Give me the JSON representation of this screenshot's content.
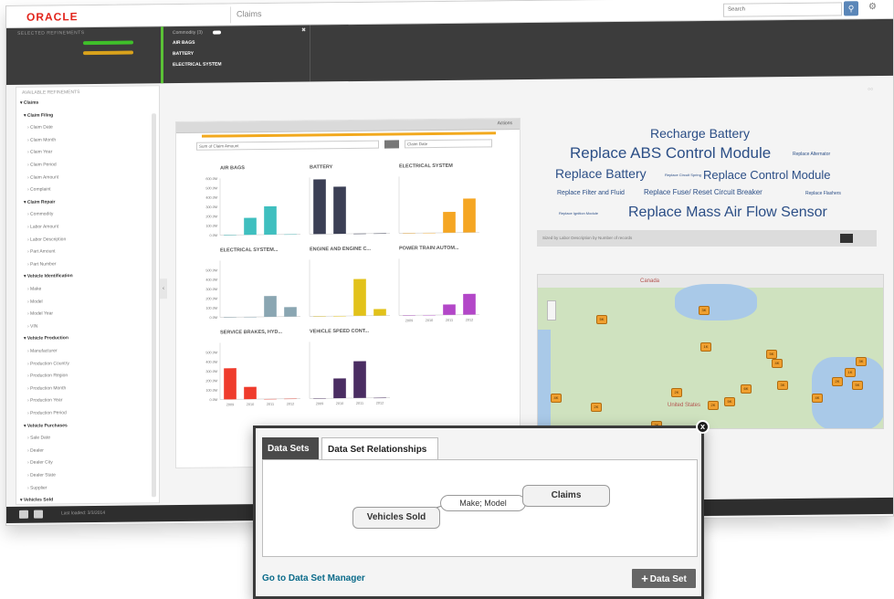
{
  "header": {
    "logo": "ORACLE",
    "app_title": "Claims",
    "search_placeholder": "Search"
  },
  "refinements": {
    "heading": "SELECTED REFINEMENTS",
    "rows": [
      {
        "label": "",
        "value": "",
        "color": "#3fbf2a"
      },
      {
        "label": "",
        "value": "",
        "color": "#d9a21c"
      }
    ],
    "attribute_title": "Commodity (3)",
    "attribute_values": [
      "AIR BAGS",
      "BATTERY",
      "ELECTRICAL SYSTEM"
    ]
  },
  "sidebar": {
    "title": "AVAILABLE REFINEMENTS",
    "groups": [
      {
        "label": "Claims",
        "items": [
          {
            "label": "Claim Filing",
            "group": true
          },
          {
            "label": "Claim Date"
          },
          {
            "label": "Claim Month"
          },
          {
            "label": "Claim Year"
          },
          {
            "label": "Claim Period"
          },
          {
            "label": "Claim Amount"
          },
          {
            "label": "Complaint"
          },
          {
            "label": "Claim Repair",
            "group": true
          },
          {
            "label": "Commodity"
          },
          {
            "label": "Labor Amount"
          },
          {
            "label": "Labor Description"
          },
          {
            "label": "Part Amount"
          },
          {
            "label": "Part Number"
          },
          {
            "label": "Vehicle Identification",
            "group": true
          },
          {
            "label": "Make"
          },
          {
            "label": "Model"
          },
          {
            "label": "Model Year"
          },
          {
            "label": "VIN"
          },
          {
            "label": "Vehicle Production",
            "group": true
          },
          {
            "label": "Manufacturer"
          },
          {
            "label": "Production Country"
          },
          {
            "label": "Production Region"
          },
          {
            "label": "Production Month"
          },
          {
            "label": "Production Year"
          },
          {
            "label": "Production Period"
          },
          {
            "label": "Vehicle Purchases",
            "group": true
          },
          {
            "label": "Sale Date"
          },
          {
            "label": "Dealer"
          },
          {
            "label": "Dealer City"
          },
          {
            "label": "Dealer State"
          },
          {
            "label": "Supplier"
          }
        ]
      },
      {
        "label": "Vehicles Sold",
        "items": []
      }
    ]
  },
  "chart_panel": {
    "actions_label": "Actions",
    "metric_select": "Sum of Claim Amount",
    "time_select": "Claim Date",
    "cells": [
      {
        "title": "AIR BAGS"
      },
      {
        "title": "BATTERY"
      },
      {
        "title": "ELECTRICAL SYSTEM"
      },
      {
        "title": "ELECTRICAL SYSTEM..."
      },
      {
        "title": "ENGINE AND ENGINE C..."
      },
      {
        "title": "POWER TRAIN:AUTOM..."
      },
      {
        "title": "SERVICE BRAKES, HYD..."
      },
      {
        "title": "VEHICLE SPEED CONT..."
      }
    ]
  },
  "chart_data": [
    {
      "type": "bar",
      "title": "AIR BAGS",
      "categories": [
        "2009",
        "2010",
        "2011",
        "2012"
      ],
      "values": [
        0,
        180,
        300,
        0
      ],
      "color": "#3fbfbf",
      "ylim": [
        0,
        600
      ],
      "ylabels": [
        "0.0M",
        "100.0M",
        "200.0M",
        "300.0M",
        "400.0M",
        "500.0M",
        "600.0M"
      ]
    },
    {
      "type": "bar",
      "title": "BATTERY",
      "categories": [
        "2009",
        "2010",
        "2011",
        "2012"
      ],
      "values": [
        580,
        500,
        0,
        0
      ],
      "color": "#3b3f55",
      "ylim": [
        0,
        600
      ]
    },
    {
      "type": "bar",
      "title": "ELECTRICAL SYSTEM",
      "categories": [
        "2009",
        "2010",
        "2011",
        "2012"
      ],
      "values": [
        0,
        0,
        220,
        360
      ],
      "color": "#f5a623",
      "ylim": [
        0,
        600
      ]
    },
    {
      "type": "bar",
      "title": "ELECTRICAL SYSTEM...",
      "categories": [
        "2009",
        "2010",
        "2011",
        "2012"
      ],
      "values": [
        0,
        0,
        220,
        100
      ],
      "color": "#8aa6b2",
      "ylim": [
        0,
        600
      ],
      "ylabels": [
        "0.0M",
        "100.0M",
        "200.0M",
        "300.0M",
        "400.0M",
        "500.0M"
      ]
    },
    {
      "type": "bar",
      "title": "ENGINE AND ENGINE C...",
      "categories": [
        "2009",
        "2010",
        "2011",
        "2012"
      ],
      "values": [
        0,
        0,
        390,
        70
      ],
      "color": "#e2c21a",
      "ylim": [
        0,
        600
      ]
    },
    {
      "type": "bar",
      "title": "POWER TRAIN:AUTOM...",
      "categories": [
        "2009",
        "2010",
        "2011",
        "2012"
      ],
      "values": [
        0,
        0,
        110,
        220
      ],
      "color": "#b347c8",
      "ylim": [
        0,
        600
      ]
    },
    {
      "type": "bar",
      "title": "SERVICE BRAKES, HYD...",
      "categories": [
        "2009",
        "2010",
        "2011",
        "2012"
      ],
      "values": [
        330,
        130,
        0,
        0
      ],
      "color": "#ef3b2c",
      "ylim": [
        0,
        600
      ],
      "ylabels": [
        "0.0M",
        "100.0M",
        "200.0M",
        "300.0M",
        "400.0M",
        "500.0M"
      ]
    },
    {
      "type": "bar",
      "title": "VEHICLE SPEED CONT...",
      "categories": [
        "2009",
        "2010",
        "2011",
        "2012"
      ],
      "values": [
        0,
        210,
        390,
        0
      ],
      "color": "#4a2d62",
      "ylim": [
        0,
        600
      ]
    }
  ],
  "tag_cloud": {
    "words": [
      {
        "text": "Recharge Battery",
        "size": 14
      },
      {
        "text": "Replace ABS Control Module",
        "size": 17
      },
      {
        "text": "Replace Alternator",
        "size": 5
      },
      {
        "text": "Replace Battery",
        "size": 14
      },
      {
        "text": "Replace Circuit Spring",
        "size": 4
      },
      {
        "text": "Replace Control Module",
        "size": 13
      },
      {
        "text": "Replace Filter and Fluid",
        "size": 7
      },
      {
        "text": "Replace Fuse/ Reset Circuit Breaker",
        "size": 8
      },
      {
        "text": "Replace Flashers",
        "size": 5
      },
      {
        "text": "Replace Ignition Module",
        "size": 4
      },
      {
        "text": "Replace Mass Air Flow Sensor",
        "size": 16
      }
    ],
    "footer": "Sized by Labor Description    by Number of records"
  },
  "map": {
    "country_label": "Canada",
    "region_label": "United States",
    "markers": [
      "5K",
      "3K",
      "1K",
      "5K",
      "4K",
      "3K",
      "6K",
      "5K",
      "2K",
      "4K",
      "1K",
      "3K",
      "2K",
      "5K",
      "4K",
      "2K",
      "3K",
      "2K"
    ]
  },
  "bottom_bar": {
    "status": "Last loaded: 3/3/2014"
  },
  "dialog": {
    "tabs": [
      {
        "label": "Data Sets",
        "active": false
      },
      {
        "label": "Data Set Relationships",
        "active": true
      }
    ],
    "nodes": {
      "left": "Vehicles Sold",
      "right": "Claims"
    },
    "relationship_label": "Make; Model",
    "link_text": "Go to Data Set Manager",
    "add_button": "Data Set",
    "close_label": "x"
  }
}
